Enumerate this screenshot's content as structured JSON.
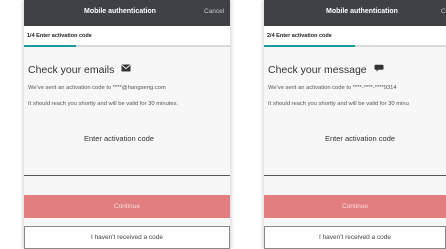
{
  "screens": [
    {
      "title": "Mobile authentication",
      "cancel_label": "Cancel",
      "step_label": "1/4 Enter activation code",
      "step_progress": 0.25,
      "heading": "Check your emails",
      "heading_icon": "envelope-icon",
      "sent_text": "We've sent an activation code to ****@hangseng.com",
      "valid_text": "It should reach you shortly and will be valid for 30 minutes.",
      "code_label": "Enter activation code",
      "code_value": "",
      "continue_label": "Continue",
      "no_code_label": "I haven't received a code"
    },
    {
      "title": "Mobile authentication",
      "cancel_label": "C",
      "step_label": "2/4 Enter activation code",
      "step_progress": 0.5,
      "heading": "Check your message",
      "heading_icon": "message-bubble-icon",
      "sent_text": "We've sent an activation code to ****-****-****9314",
      "valid_text": "It should reach you shortly and will be valid for 30 minu",
      "code_label": "Enter activation code",
      "code_value": "",
      "continue_label": "Continue",
      "no_code_label": "I haven't received a code"
    }
  ],
  "colors": {
    "title_bar": "#3e4244",
    "progress_accent": "#1a9a98",
    "continue_button": "#e27d80",
    "content_background": "#f7f7f7"
  }
}
